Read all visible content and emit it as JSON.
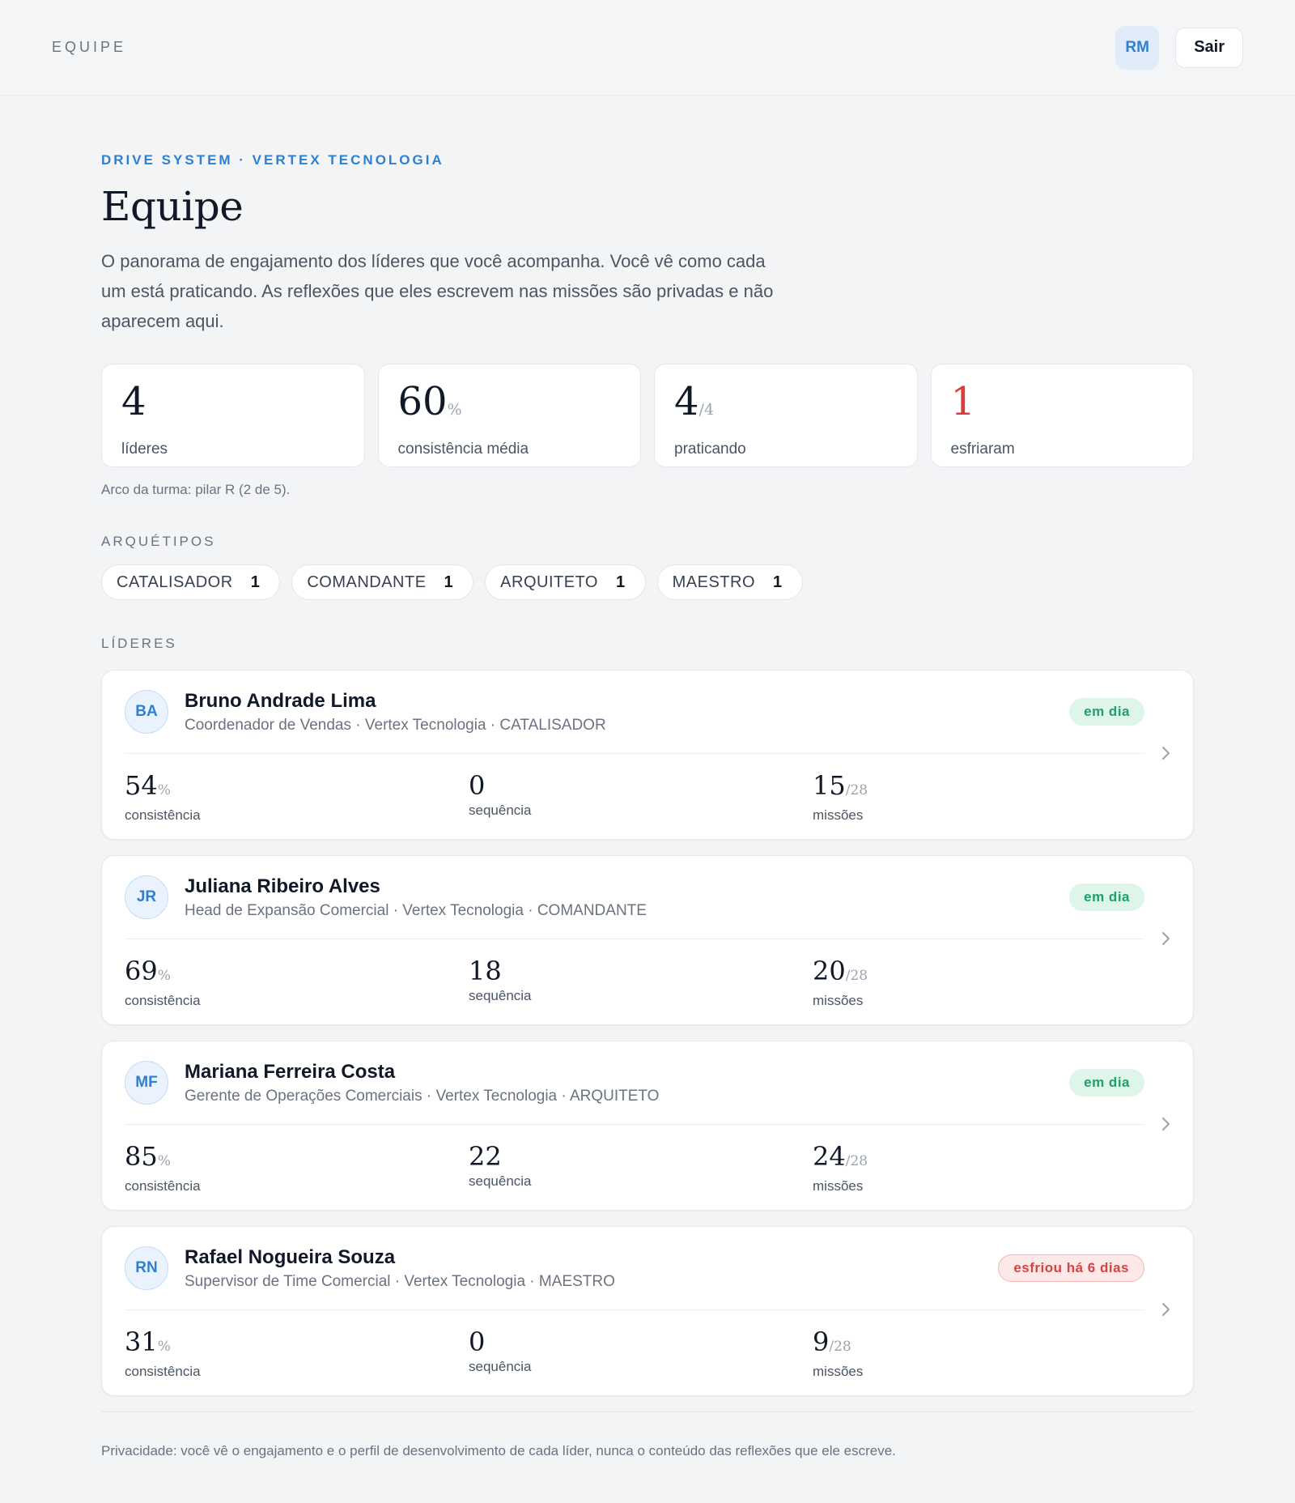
{
  "topbar": {
    "title": "EQUIPE",
    "user_initials": "RM",
    "logout_label": "Sair"
  },
  "header": {
    "eyebrow": "DRIVE SYSTEM · VERTEX TECNOLOGIA",
    "title": "Equipe",
    "intro": "O panorama de engajamento dos líderes que você acompanha. Você vê como cada um está praticando. As reflexões que eles escrevem nas missões são privadas e não aparecem aqui."
  },
  "stats": [
    {
      "value": "4",
      "suffix": "",
      "label": "líderes"
    },
    {
      "value": "60",
      "suffix": "%",
      "label": "consistência média"
    },
    {
      "value": "4",
      "suffix": "/4",
      "label": "praticando"
    },
    {
      "value": "1",
      "suffix": "",
      "label": "esfriaram"
    }
  ],
  "arc_note": "Arco da turma: pilar R (2 de 5).",
  "archetypes": {
    "label": "ARQUÉTIPOS",
    "items": [
      {
        "name": "CATALISADOR",
        "count": "1"
      },
      {
        "name": "COMANDANTE",
        "count": "1"
      },
      {
        "name": "ARQUITETO",
        "count": "1"
      },
      {
        "name": "MAESTRO",
        "count": "1"
      }
    ]
  },
  "leaders": {
    "label": "LÍDERES",
    "items": [
      {
        "initials": "BA",
        "name": "Bruno Andrade Lima",
        "role": "Coordenador de Vendas · Vertex Tecnologia · CATALISADOR",
        "status": "em dia",
        "consistency": "54",
        "consistency_suffix": "%",
        "consistency_label": "consistência",
        "streak": "0",
        "streak_label": "sequência",
        "missions": "15",
        "missions_suffix": "/28",
        "missions_label": "missões"
      },
      {
        "initials": "JR",
        "name": "Juliana Ribeiro Alves",
        "role": "Head de Expansão Comercial · Vertex Tecnologia · COMANDANTE",
        "status": "em dia",
        "consistency": "69",
        "consistency_suffix": "%",
        "consistency_label": "consistência",
        "streak": "18",
        "streak_label": "sequência",
        "missions": "20",
        "missions_suffix": "/28",
        "missions_label": "missões"
      },
      {
        "initials": "MF",
        "name": "Mariana Ferreira Costa",
        "role": "Gerente de Operações Comerciais · Vertex Tecnologia · ARQUITETO",
        "status": "em dia",
        "consistency": "85",
        "consistency_suffix": "%",
        "consistency_label": "consistência",
        "streak": "22",
        "streak_label": "sequência",
        "missions": "24",
        "missions_suffix": "/28",
        "missions_label": "missões"
      },
      {
        "initials": "RN",
        "name": "Rafael Nogueira Souza",
        "role": "Supervisor de Time Comercial · Vertex Tecnologia · MAESTRO",
        "status": "esfriou há 6 dias",
        "consistency": "31",
        "consistency_suffix": "%",
        "consistency_label": "consistência",
        "streak": "0",
        "streak_label": "sequência",
        "missions": "9",
        "missions_suffix": "/28",
        "missions_label": "missões"
      }
    ]
  },
  "footer": {
    "privacy_note": "Privacidade: você vê o engajamento e o perfil de desenvolvimento de cada líder, nunca o conteúdo das reflexões que ele escreve."
  },
  "colors": {
    "accent": "#2f7fd1",
    "ok": "#1fa067",
    "alert": "#dc3b3b"
  }
}
